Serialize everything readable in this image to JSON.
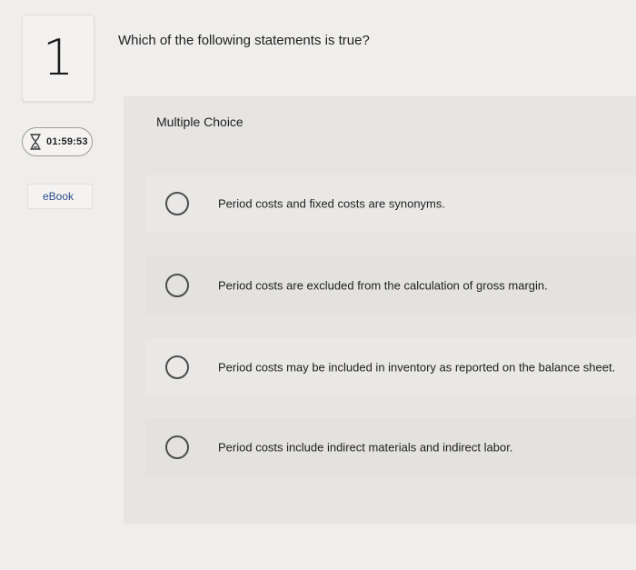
{
  "question": {
    "number": "1",
    "prompt": "Which of the following statements is true?"
  },
  "timer": {
    "value": "01:59:53",
    "icon": "hourglass-icon"
  },
  "sidebar": {
    "ebook_label": "eBook"
  },
  "answer_section": {
    "type_label": "Multiple Choice",
    "options": [
      {
        "text": "Period costs and fixed costs are synonyms.",
        "selected": false
      },
      {
        "text": "Period costs are excluded from the calculation of gross margin.",
        "selected": false
      },
      {
        "text": "Period costs may be included in inventory as reported on the balance sheet.",
        "selected": false
      },
      {
        "text": "Period costs include indirect materials and indirect labor.",
        "selected": false
      }
    ]
  }
}
